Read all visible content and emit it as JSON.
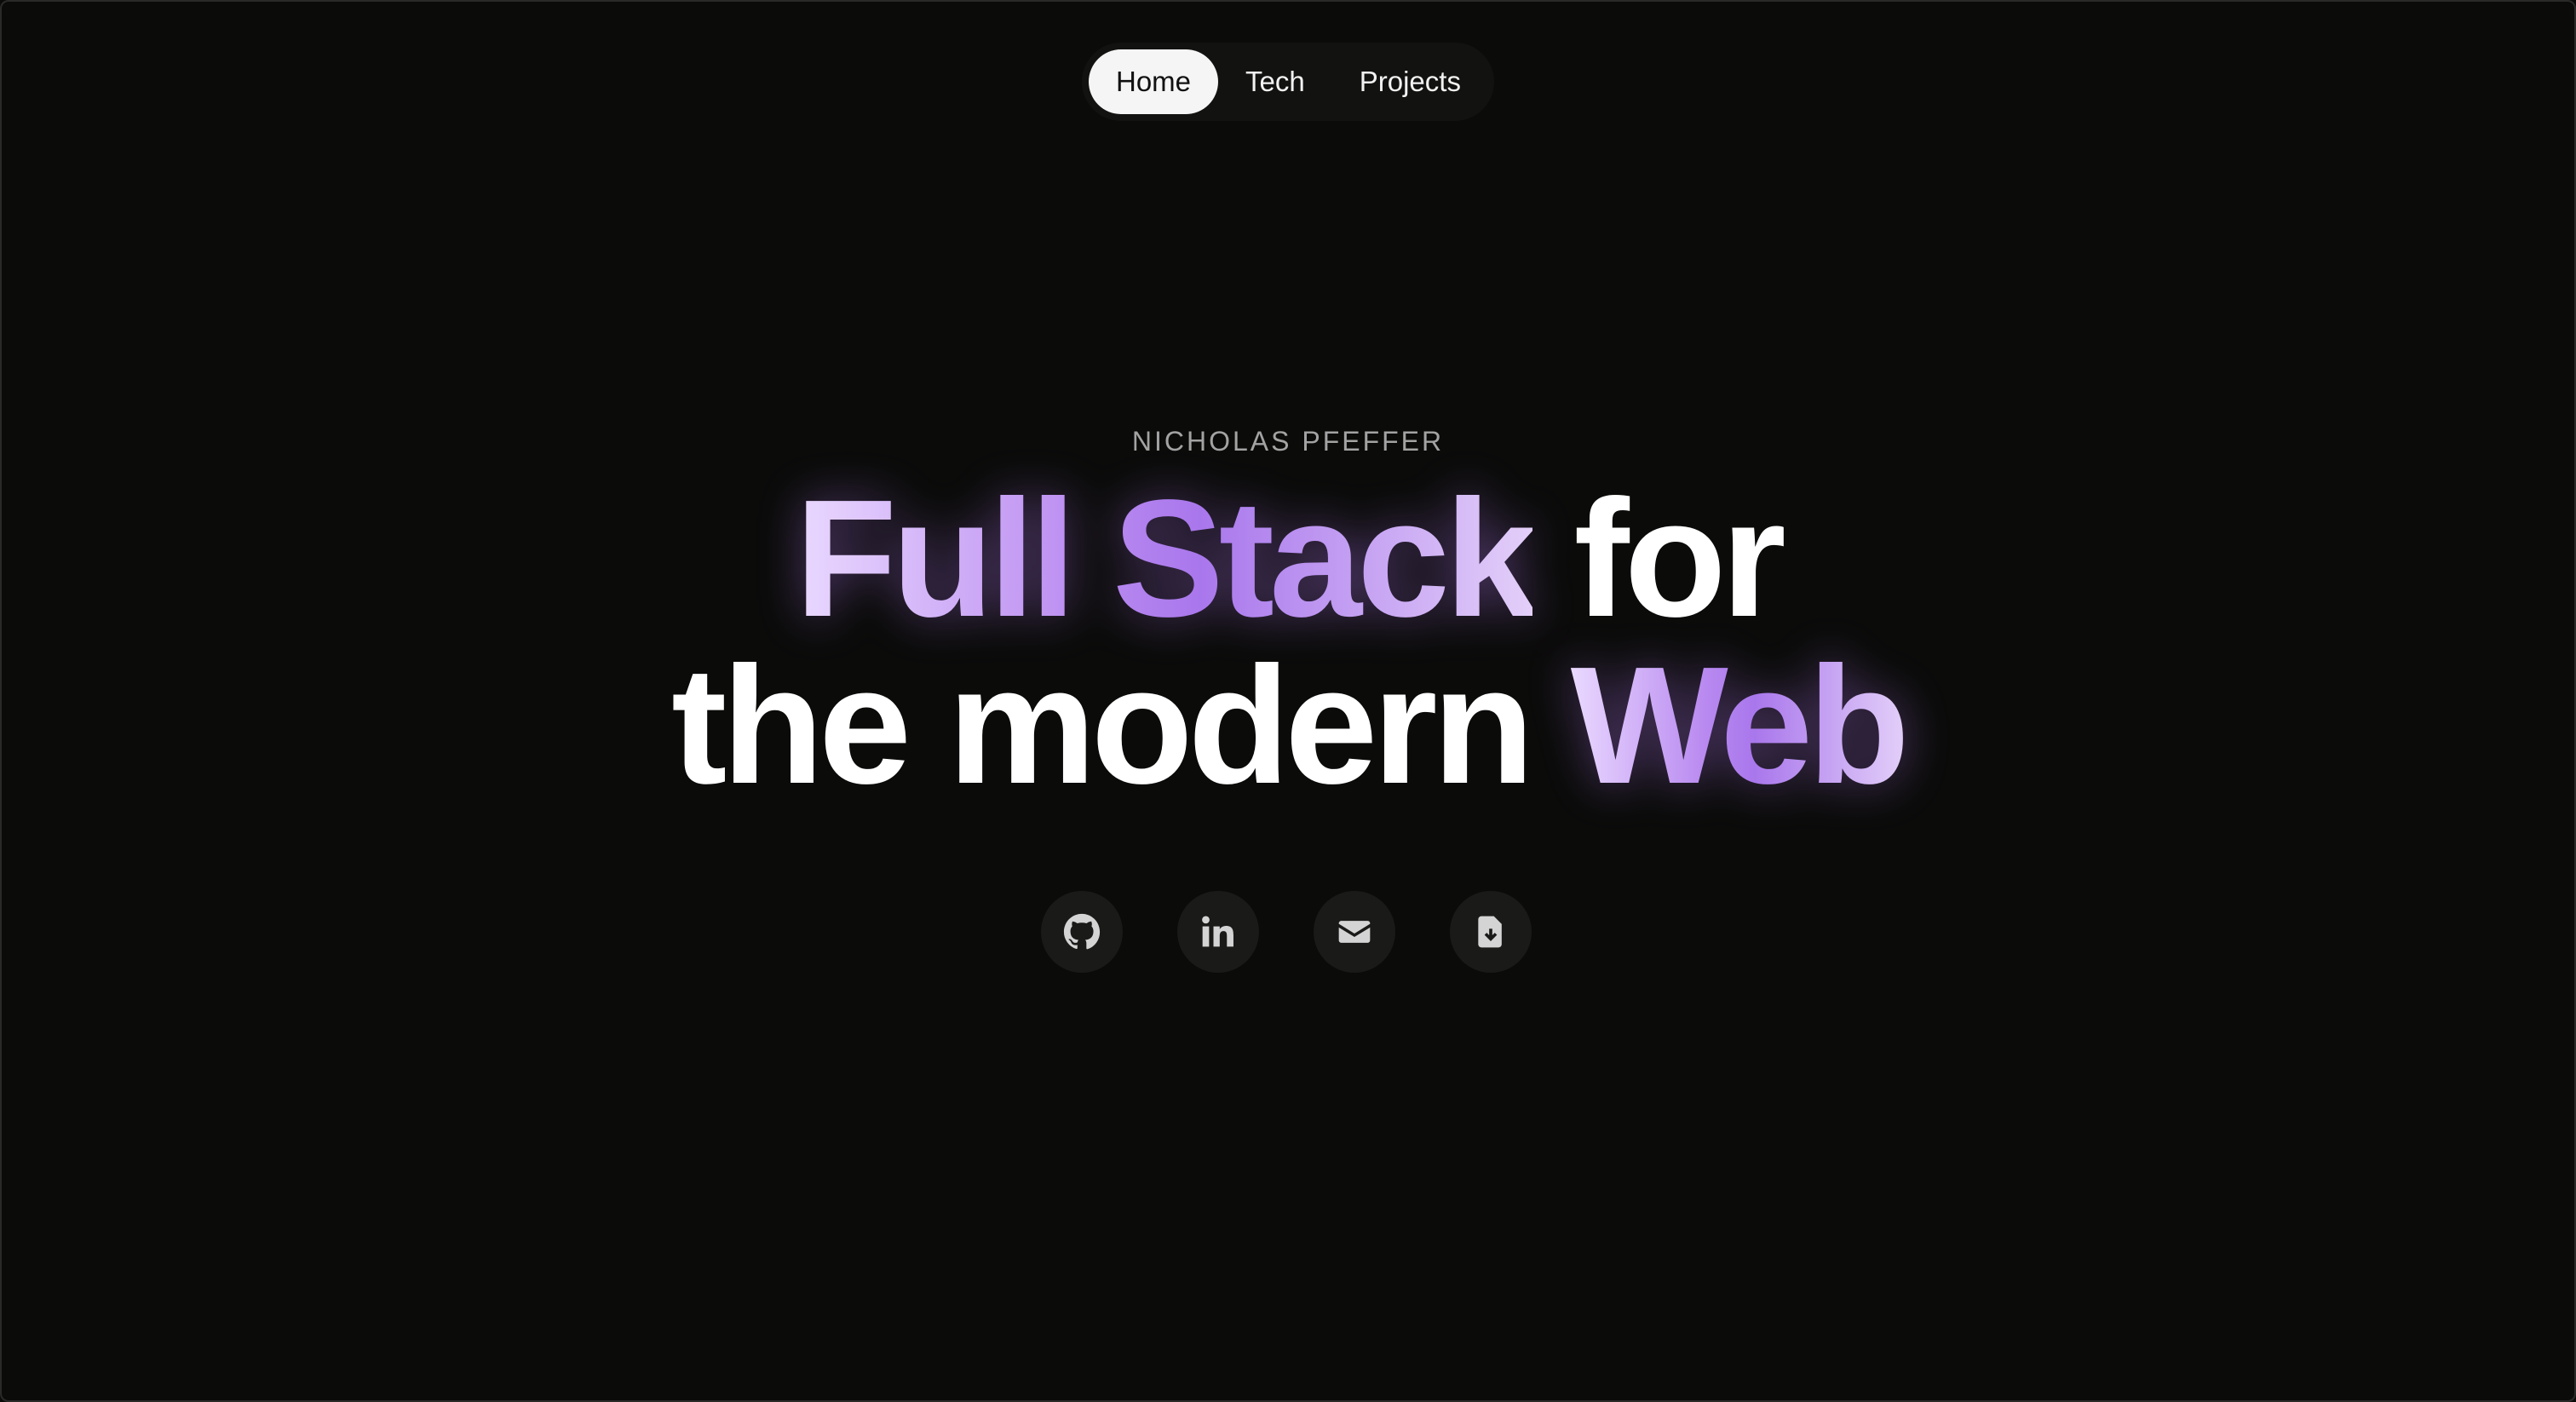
{
  "nav": {
    "items": [
      {
        "label": "Home",
        "active": true
      },
      {
        "label": "Tech",
        "active": false
      },
      {
        "label": "Projects",
        "active": false
      }
    ]
  },
  "hero": {
    "eyebrow": "NICHOLAS PFEFFER",
    "headline": {
      "line1_accent": "Full Stack",
      "line1_plain": "for",
      "line2_plain": "the modern",
      "line2_accent": "Web"
    },
    "accent_gradient": [
      "#ead9ff",
      "#b98af0",
      "#a977ec",
      "#e3cff9"
    ]
  },
  "socials": [
    {
      "icon": "github-icon"
    },
    {
      "icon": "linkedin-icon"
    },
    {
      "icon": "mail-icon"
    },
    {
      "icon": "download-file-icon"
    }
  ],
  "colors": {
    "background": "#0b0b0a",
    "nav_background": "#121211",
    "nav_active_background": "#f5f5f5",
    "social_button_background": "#1a1a19",
    "icon_color": "#d4d4d4"
  }
}
